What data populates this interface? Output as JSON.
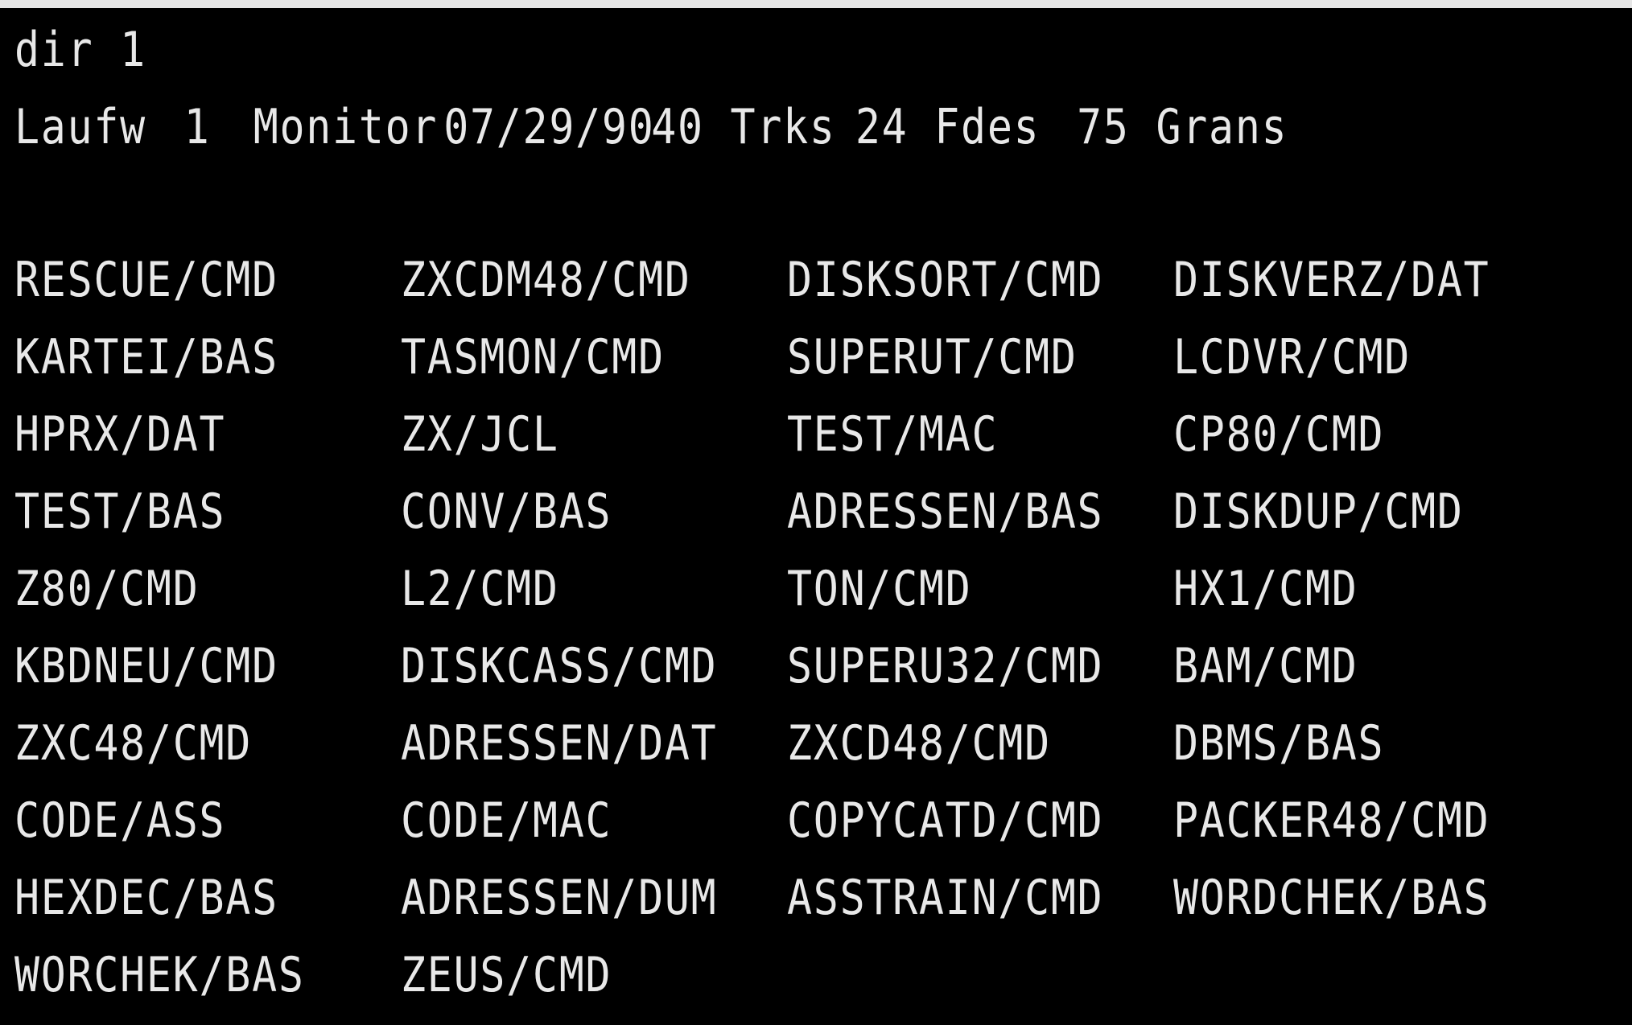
{
  "terminal": {
    "command": "dir 1",
    "info": {
      "drive_label": "Laufw",
      "drive_number": "1",
      "disk_name": "Monitor",
      "date": "07/29/90",
      "tracks": "40 Trks",
      "fdes": "24 Fdes",
      "grans": "75 Grans"
    },
    "files": [
      [
        "RESCUE/CMD",
        "ZXCDM48/CMD",
        "DISKSORT/CMD",
        "DISKVERZ/DAT"
      ],
      [
        "KARTEI/BAS",
        "TASMON/CMD",
        "SUPERUT/CMD",
        "LCDVR/CMD"
      ],
      [
        "HPRX/DAT",
        "ZX/JCL",
        "TEST/MAC",
        "CP80/CMD"
      ],
      [
        "TEST/BAS",
        "CONV/BAS",
        "ADRESSEN/BAS",
        "DISKDUP/CMD"
      ],
      [
        "Z80/CMD",
        "L2/CMD",
        "TON/CMD",
        "HX1/CMD"
      ],
      [
        "KBDNEU/CMD",
        "DISKCASS/CMD",
        "SUPERU32/CMD",
        "BAM/CMD"
      ],
      [
        "ZXC48/CMD",
        "ADRESSEN/DAT",
        "ZXCD48/CMD",
        "DBMS/BAS"
      ],
      [
        "CODE/ASS",
        "CODE/MAC",
        "COPYCATD/CMD",
        "PACKER48/CMD"
      ],
      [
        "HEXDEC/BAS",
        "ADRESSEN/DUM",
        "ASSTRAIN/CMD",
        "WORDCHEK/BAS"
      ],
      [
        "WORCHEK/BAS",
        "ZEUS/CMD"
      ]
    ]
  },
  "colors": {
    "background": "#000000",
    "text": "#e8e8e8",
    "frame": "#e6e6e6"
  }
}
